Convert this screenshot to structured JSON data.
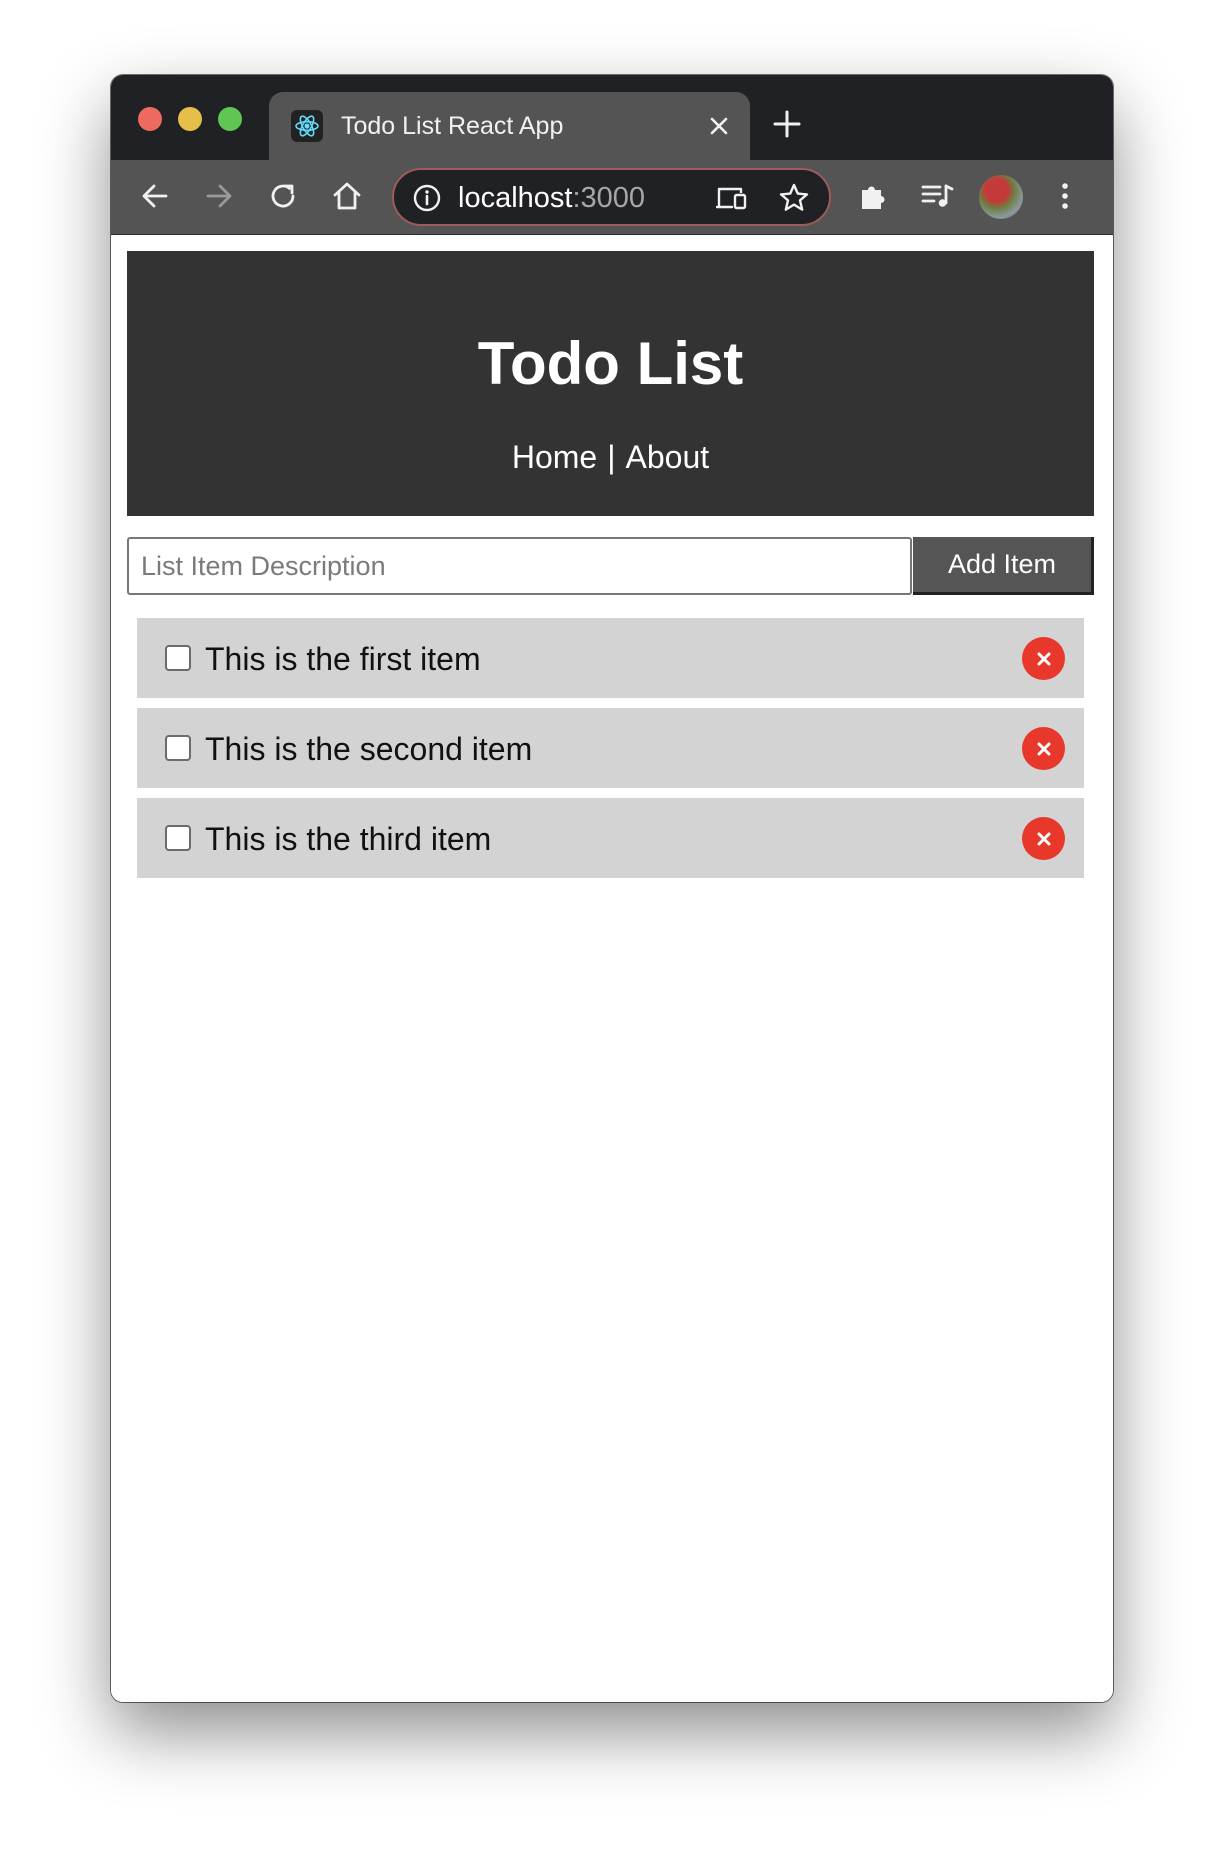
{
  "browser": {
    "tab_title": "Todo List React App",
    "url_host": "localhost",
    "url_port": ":3000"
  },
  "app": {
    "title": "Todo List",
    "nav": {
      "home": "Home",
      "separator": "|",
      "about": "About"
    },
    "form": {
      "placeholder": "List Item Description",
      "value": "",
      "button_label": "Add Item"
    },
    "items": [
      {
        "text": "This is the first item",
        "checked": false
      },
      {
        "text": "This is the second item",
        "checked": false
      },
      {
        "text": "This is the third item",
        "checked": false
      }
    ]
  },
  "icons": {
    "tab_favicon": "react-logo-icon",
    "tab_close": "close-icon",
    "new_tab": "plus-icon",
    "back": "arrow-left-icon",
    "forward": "arrow-right-icon",
    "reload": "reload-icon",
    "home": "home-icon",
    "site_info": "info-icon",
    "cast": "cast-icon",
    "bookmark": "star-icon",
    "extensions": "puzzle-icon",
    "media": "media-queue-icon",
    "menu": "kebab-menu-icon",
    "delete": "close-icon"
  },
  "colors": {
    "header_background": "#333333",
    "item_background": "#d3d3d3",
    "delete_button": "#e8382b",
    "add_button": "#555555"
  }
}
